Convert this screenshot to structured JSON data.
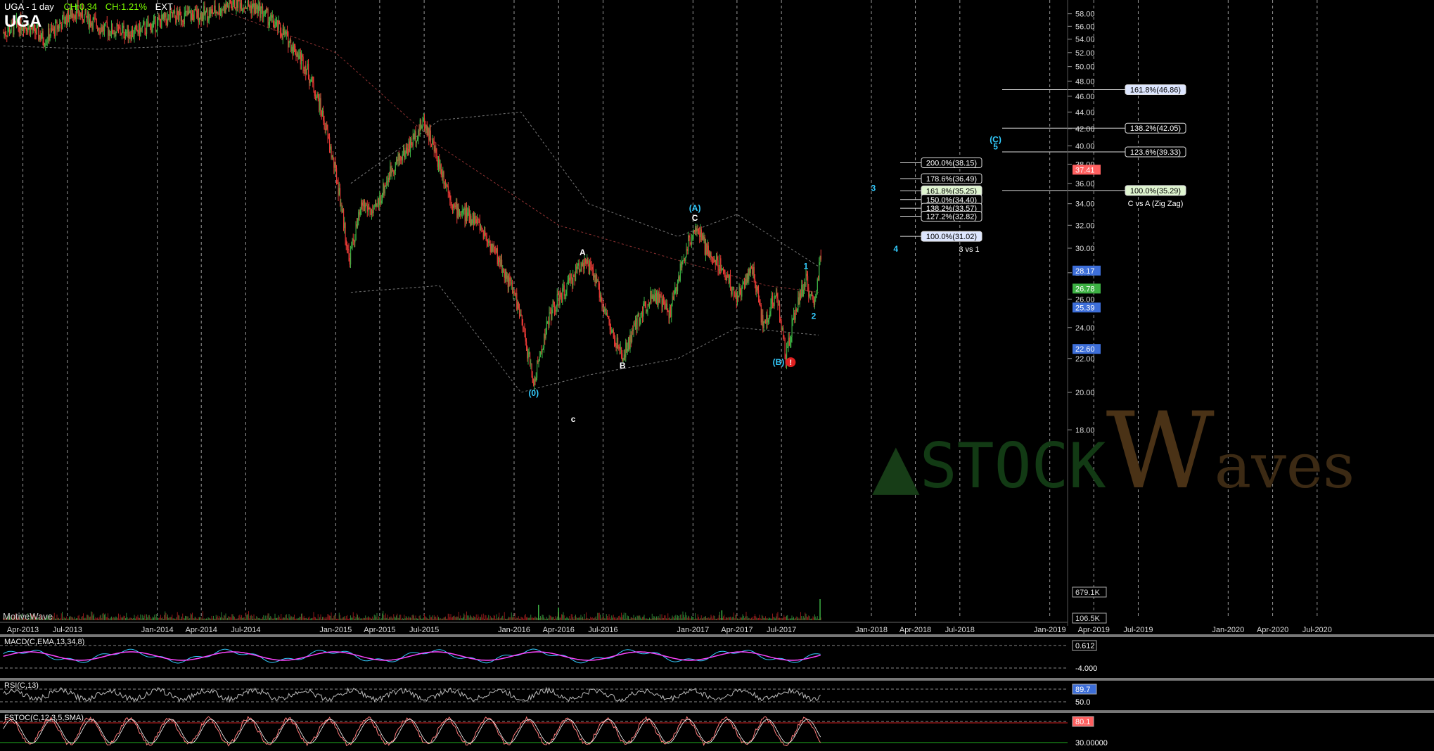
{
  "header": {
    "title": "UGA - 1 day",
    "change": "CH:0.34",
    "change_pct": "CH:1.21%",
    "ext": "EXT",
    "symbol": "UGA"
  },
  "watermark": {
    "prefix": "STOCK",
    "w": "W",
    "suffix": "aves"
  },
  "footer": {
    "brand": "MotiveWave"
  },
  "colors": {
    "background": "#000000",
    "up_candle": "#3cb043",
    "down_candle": "#e53935",
    "wave_cyan": "#33ccff",
    "fib_box": "#ffffff",
    "ema": "#ff00ff",
    "last_price_tag": "#ff5a5a",
    "green_tag": "#7CFC00"
  },
  "chart_data": {
    "type": "candlestick",
    "price_axis": {
      "scale": "log",
      "ticks": [
        "58.00",
        "56.00",
        "54.00",
        "52.00",
        "50.00",
        "48.00",
        "46.00",
        "44.00",
        "42.00",
        "40.00",
        "38.00",
        "36.00",
        "34.00",
        "32.00",
        "30.00",
        "28.00",
        "26.00",
        "24.00",
        "22.00",
        "20.00",
        "18.00"
      ],
      "range": [
        16.5,
        60
      ]
    },
    "time_axis_labels": [
      "Apr-2013",
      "Jul-2013",
      "Jan-2014",
      "Apr-2014",
      "Jul-2014",
      "Jan-2015",
      "Apr-2015",
      "Jul-2015",
      "Jan-2016",
      "Apr-2016",
      "Jul-2016",
      "Jan-2017",
      "Apr-2017",
      "Jul-2017",
      "Jan-2018",
      "Apr-2018",
      "Jul-2018",
      "Jan-2019",
      "Apr-2019",
      "Jul-2019",
      "Jan-2020",
      "Apr-2020",
      "Jul-2020"
    ],
    "price_path": [
      {
        "d": "2013-02-20",
        "p": 55.0
      },
      {
        "d": "2013-04-01",
        "p": 56.5
      },
      {
        "d": "2013-05-15",
        "p": 54.0
      },
      {
        "d": "2013-07-15",
        "p": 58.5
      },
      {
        "d": "2013-09-15",
        "p": 55.5
      },
      {
        "d": "2013-11-15",
        "p": 55.0
      },
      {
        "d": "2014-02-01",
        "p": 57.5
      },
      {
        "d": "2014-04-15",
        "p": 58.0
      },
      {
        "d": "2014-06-15",
        "p": 60.0
      },
      {
        "d": "2014-08-01",
        "p": 58.5
      },
      {
        "d": "2014-09-20",
        "p": 54.5
      },
      {
        "d": "2014-11-01",
        "p": 50.0
      },
      {
        "d": "2014-12-01",
        "p": 44.5
      },
      {
        "d": "2015-01-05",
        "p": 36.0
      },
      {
        "d": "2015-01-28",
        "p": 29.0
      },
      {
        "d": "2015-02-25",
        "p": 34.0
      },
      {
        "d": "2015-03-20",
        "p": 33.0
      },
      {
        "d": "2015-04-25",
        "p": 37.5
      },
      {
        "d": "2015-06-01",
        "p": 40.0
      },
      {
        "d": "2015-07-01",
        "p": 43.0
      },
      {
        "d": "2015-07-25",
        "p": 39.0
      },
      {
        "d": "2015-09-01",
        "p": 33.5
      },
      {
        "d": "2015-10-15",
        "p": 32.5
      },
      {
        "d": "2015-12-01",
        "p": 29.0
      },
      {
        "d": "2016-01-05",
        "p": 26.0
      },
      {
        "d": "2016-02-10",
        "p": 20.5
      },
      {
        "d": "2016-03-15",
        "p": 25.0
      },
      {
        "d": "2016-04-20",
        "p": 27.0
      },
      {
        "d": "2016-05-20",
        "p": 29.0
      },
      {
        "d": "2016-06-10",
        "p": 28.0
      },
      {
        "d": "2016-07-20",
        "p": 23.5
      },
      {
        "d": "2016-08-10",
        "p": 22.0
      },
      {
        "d": "2016-09-10",
        "p": 24.5
      },
      {
        "d": "2016-10-10",
        "p": 26.5
      },
      {
        "d": "2016-11-15",
        "p": 25.0
      },
      {
        "d": "2016-12-15",
        "p": 29.5
      },
      {
        "d": "2017-01-05",
        "p": 32.0
      },
      {
        "d": "2017-02-01",
        "p": 29.5
      },
      {
        "d": "2017-03-01",
        "p": 28.5
      },
      {
        "d": "2017-04-01",
        "p": 26.0
      },
      {
        "d": "2017-05-01",
        "p": 28.5
      },
      {
        "d": "2017-05-25",
        "p": 24.0
      },
      {
        "d": "2017-06-20",
        "p": 26.5
      },
      {
        "d": "2017-07-10",
        "p": 22.0
      },
      {
        "d": "2017-08-01",
        "p": 25.5
      },
      {
        "d": "2017-08-20",
        "p": 27.5
      },
      {
        "d": "2017-09-05",
        "p": 25.3
      },
      {
        "d": "2017-09-20",
        "p": 29.5
      }
    ],
    "bands": {
      "outer_upper": [
        {
          "d": "2015-02-01",
          "p": 36
        },
        {
          "d": "2015-08-01",
          "p": 43
        },
        {
          "d": "2016-01-15",
          "p": 44
        },
        {
          "d": "2016-06-01",
          "p": 34
        },
        {
          "d": "2016-12-01",
          "p": 31
        },
        {
          "d": "2017-04-01",
          "p": 33
        },
        {
          "d": "2017-09-15",
          "p": 28.5
        }
      ],
      "outer_lower": [
        {
          "d": "2015-02-01",
          "p": 26.5
        },
        {
          "d": "2015-08-01",
          "p": 27
        },
        {
          "d": "2016-01-15",
          "p": 20
        },
        {
          "d": "2016-06-01",
          "p": 21
        },
        {
          "d": "2016-12-01",
          "p": 22
        },
        {
          "d": "2017-04-01",
          "p": 24
        },
        {
          "d": "2017-09-15",
          "p": 23.5
        }
      ],
      "ma_slow": [
        {
          "d": "2014-06-01",
          "p": 58
        },
        {
          "d": "2015-01-01",
          "p": 52
        },
        {
          "d": "2015-08-01",
          "p": 40
        },
        {
          "d": "2016-04-01",
          "p": 32
        },
        {
          "d": "2016-12-01",
          "p": 29
        },
        {
          "d": "2017-06-01",
          "p": 27
        },
        {
          "d": "2017-09-15",
          "p": 26.5
        }
      ]
    },
    "wave_labels": [
      {
        "text": "(0)",
        "d": "2016-02-10",
        "p": 19.8,
        "color": "cyan"
      },
      {
        "text": "A",
        "d": "2016-05-20",
        "p": 29.4,
        "color": "white"
      },
      {
        "text": "B",
        "d": "2016-08-10",
        "p": 21.4,
        "color": "white"
      },
      {
        "text": "c",
        "d": "2016-05-01",
        "p": 18.4,
        "color": "white"
      },
      {
        "text": "C",
        "d": "2017-01-05",
        "p": 32.4,
        "color": "white"
      },
      {
        "text": "(A)",
        "d": "2017-01-05",
        "p": 33.3,
        "color": "cyan"
      },
      {
        "text": "(B)",
        "d": "2017-06-25",
        "p": 21.6,
        "color": "cyan"
      },
      {
        "text": "1",
        "d": "2017-08-20",
        "p": 28.3,
        "color": "cyan"
      },
      {
        "text": "2",
        "d": "2017-09-05",
        "p": 24.6,
        "color": "cyan"
      },
      {
        "text": "3",
        "d": "2018-01-05",
        "p": 35.25,
        "color": "cyan"
      },
      {
        "text": "4",
        "d": "2018-02-20",
        "p": 29.7,
        "color": "cyan"
      },
      {
        "text": "(C)",
        "d": "2018-09-12",
        "p": 40.4,
        "color": "cyan"
      },
      {
        "text": "5",
        "d": "2018-09-12",
        "p": 39.6,
        "color": "cyan"
      }
    ],
    "alert_marker": {
      "text": "!",
      "d": "2017-07-20",
      "p": 21.6
    },
    "fib_group_1": {
      "caption": "3 vs 1",
      "levels": [
        {
          "label": "200.0%(38.15)",
          "price": 38.15
        },
        {
          "label": "178.6%(36.49)",
          "price": 36.49
        },
        {
          "label": "161.8%(35.25)",
          "price": 35.25,
          "highlight": true
        },
        {
          "label": "150.0%(34.40)",
          "price": 34.4
        },
        {
          "label": "138.2%(33.57)",
          "price": 33.57
        },
        {
          "label": "127.2%(32.82)",
          "price": 32.82
        },
        {
          "label": "100.0%(31.02)",
          "price": 31.02,
          "blue": true
        }
      ]
    },
    "fib_group_2": {
      "caption": "C vs A (Zig Zag)",
      "levels": [
        {
          "label": "161.8%(46.86)",
          "price": 46.86,
          "blue": true
        },
        {
          "label": "138.2%(42.05)",
          "price": 42.05
        },
        {
          "label": "123.6%(39.33)",
          "price": 39.33
        },
        {
          "label": "100.0%(35.29)",
          "price": 35.29,
          "highlight": true
        }
      ]
    },
    "price_tags": [
      {
        "label": "37.41",
        "price": 37.41,
        "kind": "red"
      },
      {
        "label": "28.17",
        "price": 28.17,
        "kind": "blue"
      },
      {
        "label": "26.78",
        "price": 26.78,
        "kind": "green"
      },
      {
        "label": "25.39",
        "price": 25.39,
        "kind": "blue"
      },
      {
        "label": "22.60",
        "price": 22.6,
        "kind": "blue"
      }
    ],
    "volume_axis": [
      "679.1K",
      "106.5K"
    ],
    "panels": [
      {
        "name": "MACD",
        "title": "MACD(C,EMA,13,34,8)",
        "axis": [
          "0.612",
          "-4.000"
        ]
      },
      {
        "name": "RSI",
        "title": "RSI(C,13)",
        "axis": [
          "89.7",
          "50.0"
        ]
      },
      {
        "name": "STOCH",
        "title": "FSTOC(C,12,3,5,SMA)",
        "axis": [
          "80.1",
          "30.00000"
        ]
      }
    ]
  }
}
